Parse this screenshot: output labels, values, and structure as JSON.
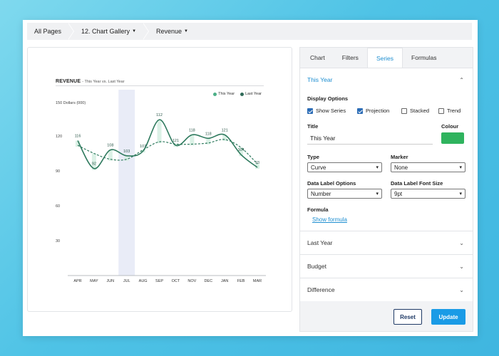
{
  "breadcrumb": [
    {
      "label": "All Pages",
      "dropdown": false
    },
    {
      "label": "12. Chart Gallery",
      "dropdown": true
    },
    {
      "label": "Revenue",
      "dropdown": true
    }
  ],
  "chart": {
    "title": "REVENUE",
    "subtitle": "- This Year vs. Last Year",
    "legend": [
      {
        "name": "This Year",
        "color": "#4caf87"
      },
      {
        "name": "Last Year",
        "color": "#2f6a58"
      }
    ],
    "ylabel": "150 Dollars (000)"
  },
  "chart_data": {
    "type": "line",
    "title": "REVENUE",
    "subtitle": "- This Year vs. Last Year",
    "ylabel": "150 Dollars (000)",
    "categories": [
      "APR",
      "MAY",
      "JUN",
      "JUL",
      "AUG",
      "SEP",
      "OCT",
      "NOV",
      "DEC",
      "JAN",
      "FEB",
      "MAR"
    ],
    "yticks": [
      30,
      60,
      90,
      120
    ],
    "ylim": [
      0,
      150
    ],
    "highlight_category": "JUL",
    "series": [
      {
        "name": "This Year",
        "color": "#2f7a5e",
        "style": "curve",
        "values": [
          116,
          92,
          108,
          103,
          107,
          134,
          112,
          121,
          118,
          121,
          104,
          93
        ]
      },
      {
        "name": "Last Year",
        "color": "#2f7a5e",
        "style": "dashed",
        "values": [
          112,
          105,
          100,
          100,
          108,
          115,
          113,
          113,
          114,
          117,
          110,
          96
        ]
      }
    ],
    "data_labels": [
      116,
      92,
      108,
      103,
      107,
      112,
      121,
      118,
      118,
      121,
      104,
      93
    ],
    "legend": "top-right",
    "grid": false
  },
  "side": {
    "tabs": [
      "Chart",
      "Filters",
      "Series",
      "Formulas"
    ],
    "active_tab": "Series",
    "open_section": "This Year",
    "display_options_label": "Display Options",
    "checkboxes": [
      {
        "label": "Show Series",
        "checked": true
      },
      {
        "label": "Projection",
        "checked": true
      },
      {
        "label": "Stacked",
        "checked": false
      },
      {
        "label": "Trend",
        "checked": false
      }
    ],
    "title_label": "Title",
    "title_value": "This Year",
    "colour_label": "Colour",
    "colour_value": "#2fb35e",
    "type_label": "Type",
    "type_value": "Curve",
    "marker_label": "Marker",
    "marker_value": "None",
    "data_label_options_label": "Data Label Options",
    "data_label_options_value": "Number",
    "data_label_font_label": "Data Label Font Size",
    "data_label_font_value": "9pt",
    "formula_label": "Formula",
    "show_formula": "Show formula",
    "collapsed_sections": [
      "Last Year",
      "Budget",
      "Difference"
    ],
    "reset_label": "Reset",
    "update_label": "Update"
  }
}
